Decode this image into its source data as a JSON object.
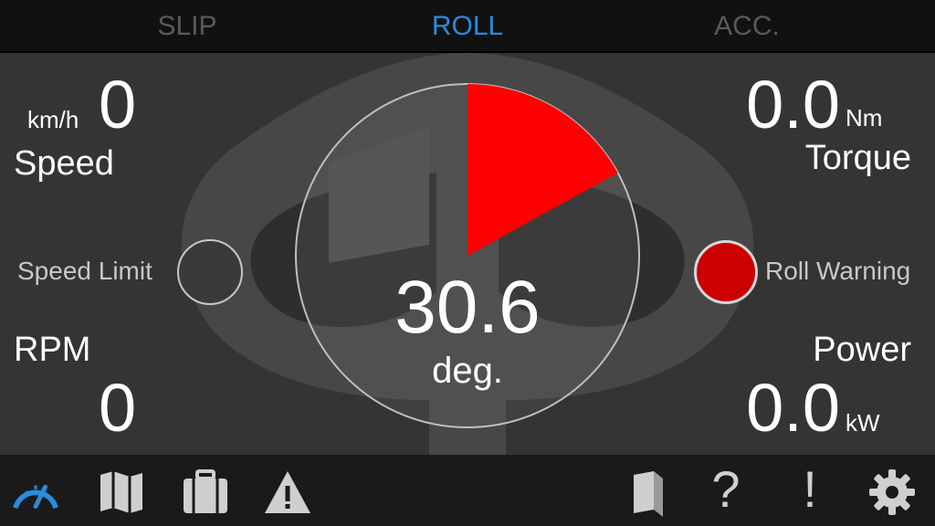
{
  "tabs": [
    {
      "label": "SLIP",
      "active": false
    },
    {
      "label": "ROLL",
      "active": true
    },
    {
      "label": "ACC.",
      "active": false
    }
  ],
  "speed": {
    "unit": "km/h",
    "value": "0",
    "label": "Speed"
  },
  "torque": {
    "value": "0.0",
    "unit": "Nm",
    "label": "Torque"
  },
  "rpm": {
    "label": "RPM",
    "value": "0"
  },
  "power": {
    "label": "Power",
    "value": "0.0",
    "unit": "kW"
  },
  "speed_limit": {
    "label": "Speed Limit",
    "active": false
  },
  "roll_warning": {
    "label": "Roll Warning",
    "active": true,
    "color": "#cc0000"
  },
  "gauge": {
    "value": "30.6",
    "unit": "deg.",
    "sector_color": "#ff0000"
  },
  "toolbar": {
    "left": [
      "speedometer-icon",
      "map-icon",
      "briefcase-icon",
      "warning-icon"
    ],
    "right": [
      "book-icon",
      "help-icon",
      "info-icon",
      "settings-icon"
    ],
    "help_glyph": "?",
    "info_glyph": "!"
  },
  "colors": {
    "accent": "#2a8be0",
    "tab_inactive": "#5a5a5a",
    "background": "#343434"
  }
}
